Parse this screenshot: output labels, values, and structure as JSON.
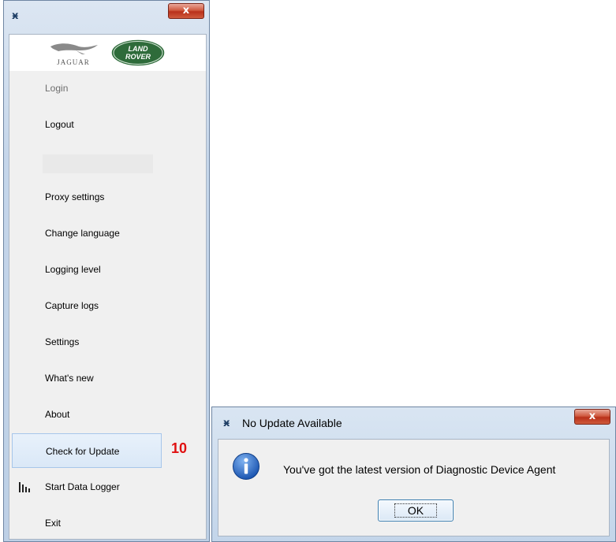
{
  "menu_window": {
    "close_label": "x",
    "logos": {
      "jaguar_text": "JAGUAR",
      "landrover_line1": "LAND",
      "landrover_line2": "ROVER"
    },
    "items": [
      {
        "label": "Login",
        "state": "disabled"
      },
      {
        "label": "Logout",
        "state": "normal"
      },
      {
        "label": "Proxy settings",
        "state": "normal"
      },
      {
        "label": "Change language",
        "state": "normal"
      },
      {
        "label": "Logging level",
        "state": "normal"
      },
      {
        "label": "Capture logs",
        "state": "normal"
      },
      {
        "label": "Settings",
        "state": "normal"
      },
      {
        "label": "What's new",
        "state": "normal"
      },
      {
        "label": "About",
        "state": "normal"
      },
      {
        "label": "Check for Update",
        "state": "highlighted"
      },
      {
        "label": "Start Data Logger",
        "state": "normal",
        "icon": "bar-chart-icon"
      },
      {
        "label": "Exit",
        "state": "normal"
      }
    ],
    "annotation_badge": "10"
  },
  "dialog": {
    "title": "No Update Available",
    "close_label": "x",
    "icon": "info-icon",
    "message": "You've got the latest version of Diagnostic Device Agent",
    "ok_label": "OK"
  },
  "colors": {
    "window_frame": "#c5d6ea",
    "close_red": "#c4452c",
    "badge_red": "#e01010",
    "info_blue": "#2a6fc9",
    "landrover_green": "#2e6b3a"
  }
}
